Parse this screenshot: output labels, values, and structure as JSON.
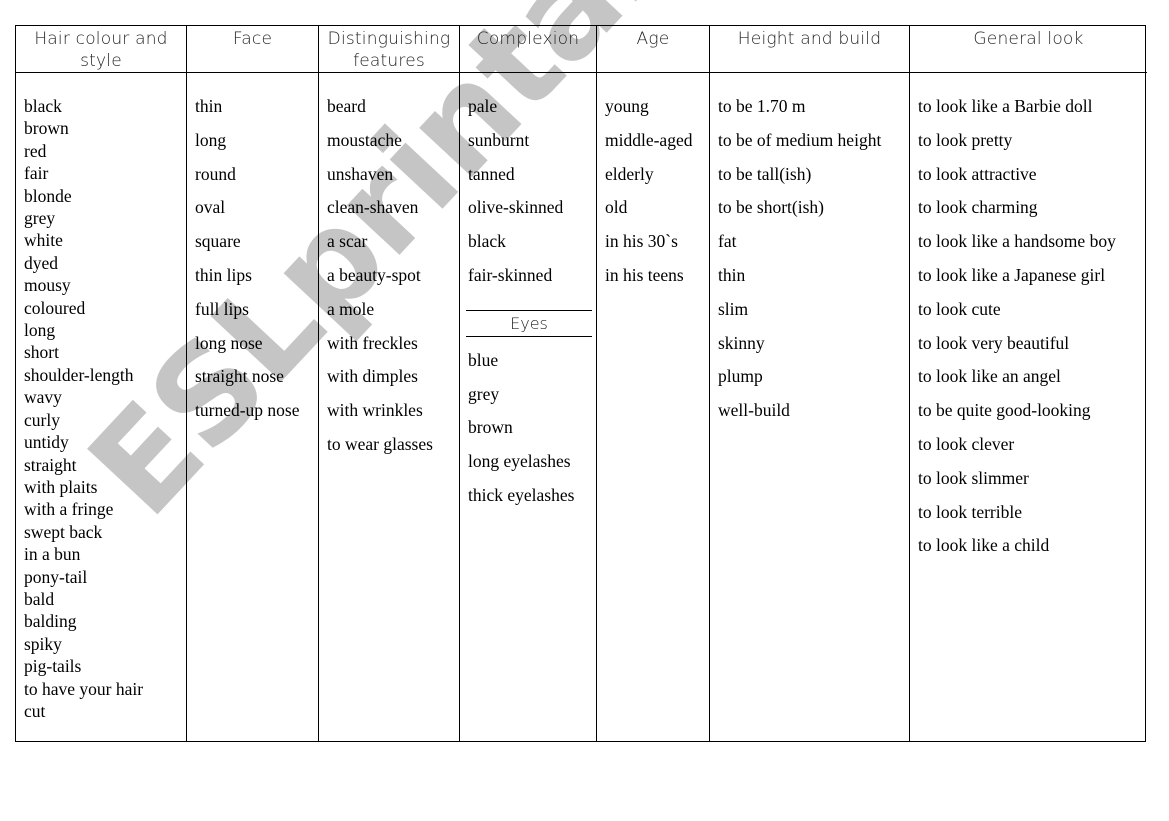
{
  "columns": [
    {
      "header": "Hair colour and style",
      "items": [
        "black",
        "brown",
        "red",
        "fair",
        "blonde",
        "grey",
        "white",
        "dyed",
        "mousy",
        "coloured",
        "long",
        "short",
        "shoulder-length",
        "wavy",
        "curly",
        "untidy",
        "straight",
        "with plaits",
        "with a fringe",
        "swept back",
        "in a bun",
        "pony-tail",
        "bald",
        "balding",
        "spiky",
        "pig-tails",
        "to have your hair",
        "cut"
      ]
    },
    {
      "header": "Face",
      "items": [
        "thin",
        "long",
        "round",
        "oval",
        "square",
        "thin lips",
        "full lips",
        "long nose",
        "straight nose",
        "turned-up nose"
      ]
    },
    {
      "header": "Distinguishing features",
      "items": [
        "beard",
        "moustache",
        "unshaven",
        "clean-shaven",
        "a scar",
        "a beauty-spot",
        "a mole",
        "with freckles",
        "with dimples",
        "with wrinkles",
        "to wear glasses"
      ]
    },
    {
      "header": "Complexion",
      "items": [
        "pale",
        "sunburnt",
        "tanned",
        "olive-skinned",
        "black",
        "fair-skinned"
      ],
      "subsection": {
        "header": "Eyes",
        "items": [
          "blue",
          "grey",
          "brown",
          "long eyelashes",
          "thick eyelashes"
        ]
      }
    },
    {
      "header": "Age",
      "items": [
        "young",
        "middle-aged",
        "elderly",
        "old",
        "in his 30`s",
        "in his teens"
      ]
    },
    {
      "header": "Height and build",
      "items": [
        "to be 1.70 m",
        "to be of medium height",
        "to be tall(ish)",
        "to be short(ish)",
        "fat",
        "thin",
        "slim",
        "skinny",
        "plump",
        "well-build"
      ]
    },
    {
      "header": "General look",
      "items": [
        "to look like a Barbie doll",
        "to look pretty",
        "to look attractive",
        "to look charming",
        "to look like a handsome boy",
        "to look like a Japanese girl",
        "to look cute",
        "to look very beautiful",
        "to look like an angel",
        "to be quite good-looking",
        "to look clever",
        "to look slimmer",
        "to look terrible",
        "to look like a child"
      ]
    }
  ],
  "watermark": "ESLprintables.com"
}
